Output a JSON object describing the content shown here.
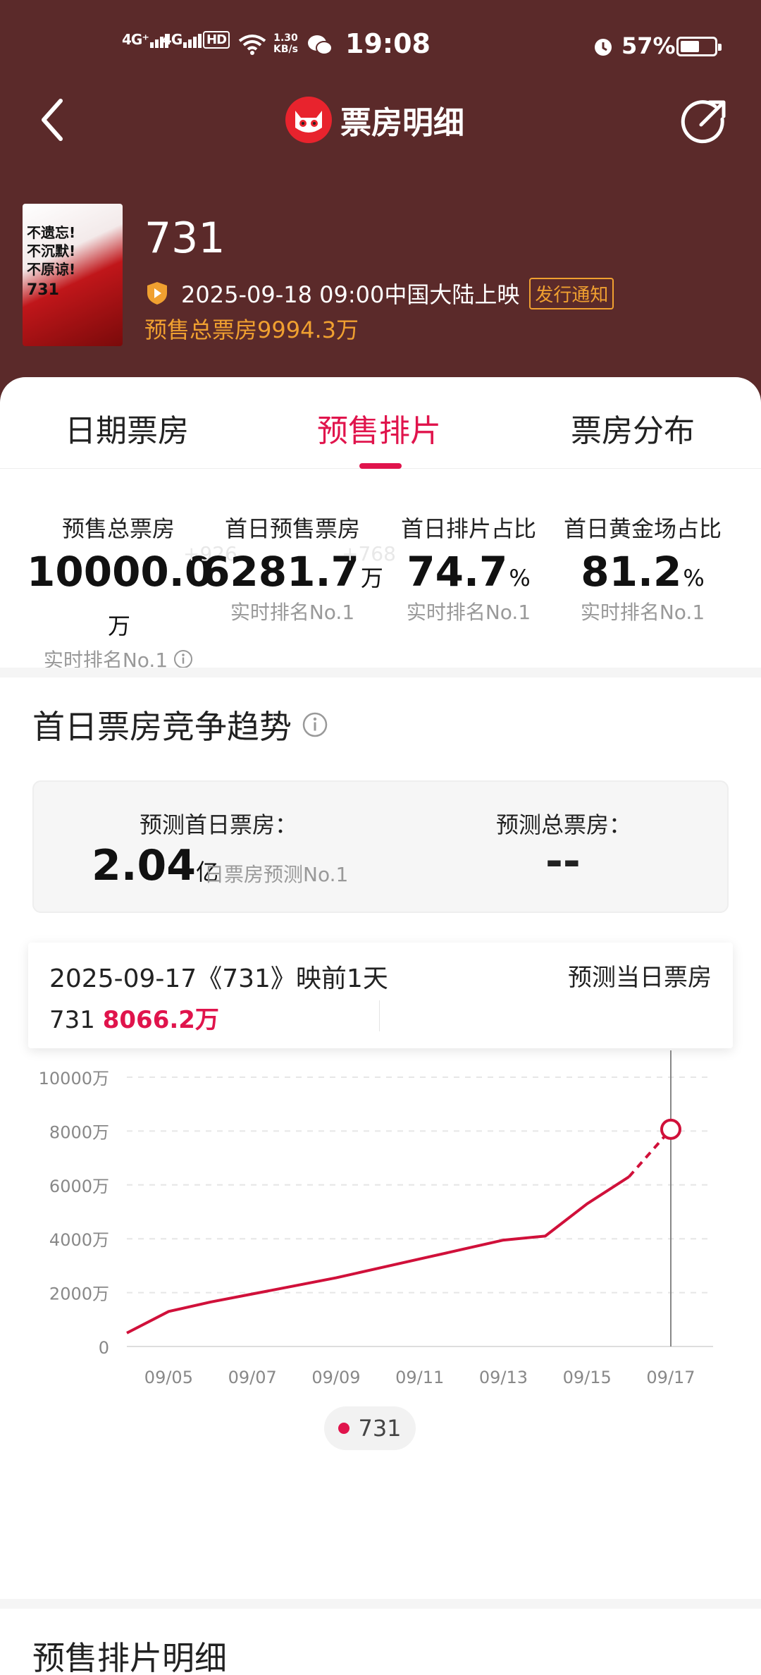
{
  "status_bar": {
    "signal_1": "4G⁺",
    "signal_2": "4G",
    "hd_label": "HD",
    "speed_value": "1.30",
    "speed_unit": "KB/s",
    "time": "19:08",
    "battery_percent": "57%",
    "battery_level": 0.57
  },
  "navbar": {
    "title": "票房明细",
    "logo_icon": "cat-eye-logo",
    "back_icon": "back-chevron-icon",
    "share_icon": "share-icon"
  },
  "movie": {
    "title": "731",
    "release_info": "2025-09-18 09:00中国大陆上映",
    "release_tag": "发行通知",
    "presale_total": "预售总票房9994.3万",
    "poster_slogan": [
      "不遗忘!",
      "不沉默!",
      "不原谅!"
    ],
    "poster_number": "731"
  },
  "tabs": [
    {
      "label": "日期票房",
      "active": false
    },
    {
      "label": "预售排片",
      "active": true
    },
    {
      "label": "票房分布",
      "active": false
    }
  ],
  "stats": [
    {
      "label": "预售总票房",
      "value": "10000.0",
      "unit": "万",
      "ghost": "+926",
      "rank": "实时排名No.1",
      "info": true
    },
    {
      "label": "首日预售票房",
      "value": "6281.7",
      "unit": "万",
      "ghost": "+768",
      "rank": "实时排名No.1",
      "info": false
    },
    {
      "label": "首日排片占比",
      "value": "74.7",
      "unit": "%",
      "ghost": "",
      "rank": "实时排名No.1",
      "info": false
    },
    {
      "label": "首日黄金场占比",
      "value": "81.2",
      "unit": "%",
      "ghost": "",
      "rank": "实时排名No.1",
      "info": false
    }
  ],
  "trend_section": {
    "title": "首日票房竞争趋势",
    "predict_first_day_label": "预测首日票房：",
    "predict_first_day_value": "2.04",
    "predict_first_day_unit": "亿",
    "predict_first_day_rank": "日票房预测No.1",
    "predict_total_label": "预测总票房：",
    "predict_total_value": "--"
  },
  "tooltip": {
    "date_line": "2025-09-17《731》映前1天",
    "predict_label": "预测当日票房",
    "series_name": "731",
    "value": "8066.2万"
  },
  "chart_data": {
    "type": "line",
    "x": [
      "09/04",
      "09/05",
      "09/06",
      "09/07",
      "09/08",
      "09/09",
      "09/10",
      "09/11",
      "09/12",
      "09/13",
      "09/14",
      "09/15",
      "09/16",
      "09/17"
    ],
    "x_tick_labels": [
      "09/05",
      "09/07",
      "09/09",
      "09/11",
      "09/13",
      "09/15",
      "09/17"
    ],
    "y_tick_labels": [
      "0",
      "2000万",
      "4000万",
      "6000万",
      "8000万",
      "10000万"
    ],
    "y_ticks": [
      0,
      2000,
      4000,
      6000,
      8000,
      10000
    ],
    "ylim": [
      0,
      10000
    ],
    "series": [
      {
        "name": "731",
        "color": "#d0103a",
        "values": [
          500,
          1300,
          1650,
          1950,
          2250,
          2550,
          2900,
          3250,
          3600,
          3950,
          4100,
          5300,
          6300,
          8066.2
        ],
        "predicted_from_index": 12
      }
    ],
    "highlight_index": 13,
    "grid": true,
    "legend_position": "bottom-center"
  },
  "legend_label": "731",
  "bottom_section_title": "预售排片明细"
}
